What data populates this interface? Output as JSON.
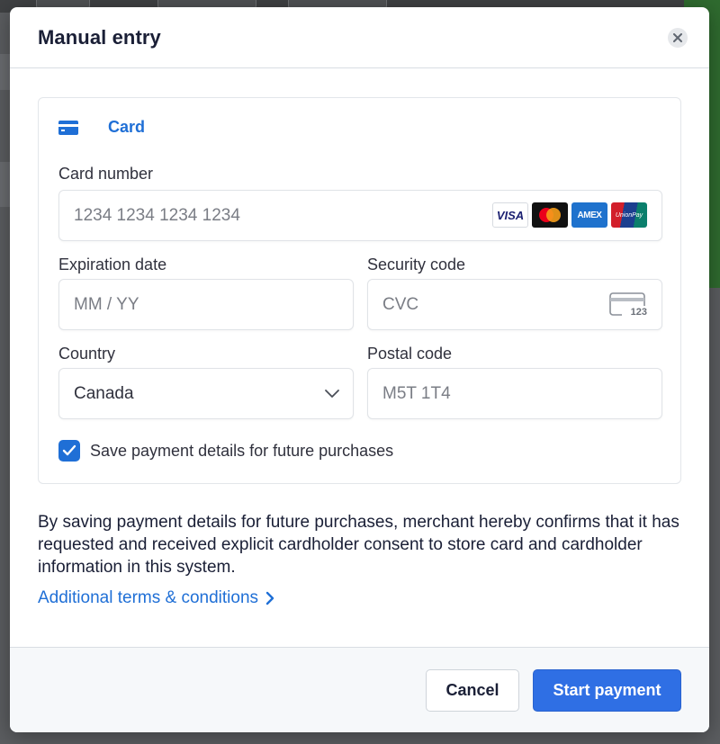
{
  "modal": {
    "title": "Manual entry",
    "close_icon": "close-icon"
  },
  "payment_method_tab": {
    "label": "Card",
    "icon": "credit-card-icon",
    "accent": "#1f6fd6"
  },
  "form": {
    "card_number": {
      "label": "Card number",
      "placeholder": "1234 1234 1234 1234",
      "brands": [
        "VISA",
        "Mastercard",
        "AMEX",
        "UnionPay"
      ]
    },
    "expiration": {
      "label": "Expiration date",
      "placeholder": "MM / YY"
    },
    "security_code": {
      "label": "Security code",
      "placeholder": "CVC",
      "icon_text": "123"
    },
    "country": {
      "label": "Country",
      "value": "Canada"
    },
    "postal_code": {
      "label": "Postal code",
      "placeholder": "M5T 1T4"
    },
    "save_details": {
      "label": "Save payment details for future purchases",
      "checked": true
    }
  },
  "consent_text": "By saving payment details for future purchases, merchant hereby confirms that it has requested and received explicit cardholder consent to store card and cardholder information in this system.",
  "terms_link": "Additional terms & conditions",
  "footer": {
    "cancel_label": "Cancel",
    "start_label": "Start payment"
  },
  "colors": {
    "primary_button": "#2f6fe4",
    "link": "#1f6fd6"
  }
}
